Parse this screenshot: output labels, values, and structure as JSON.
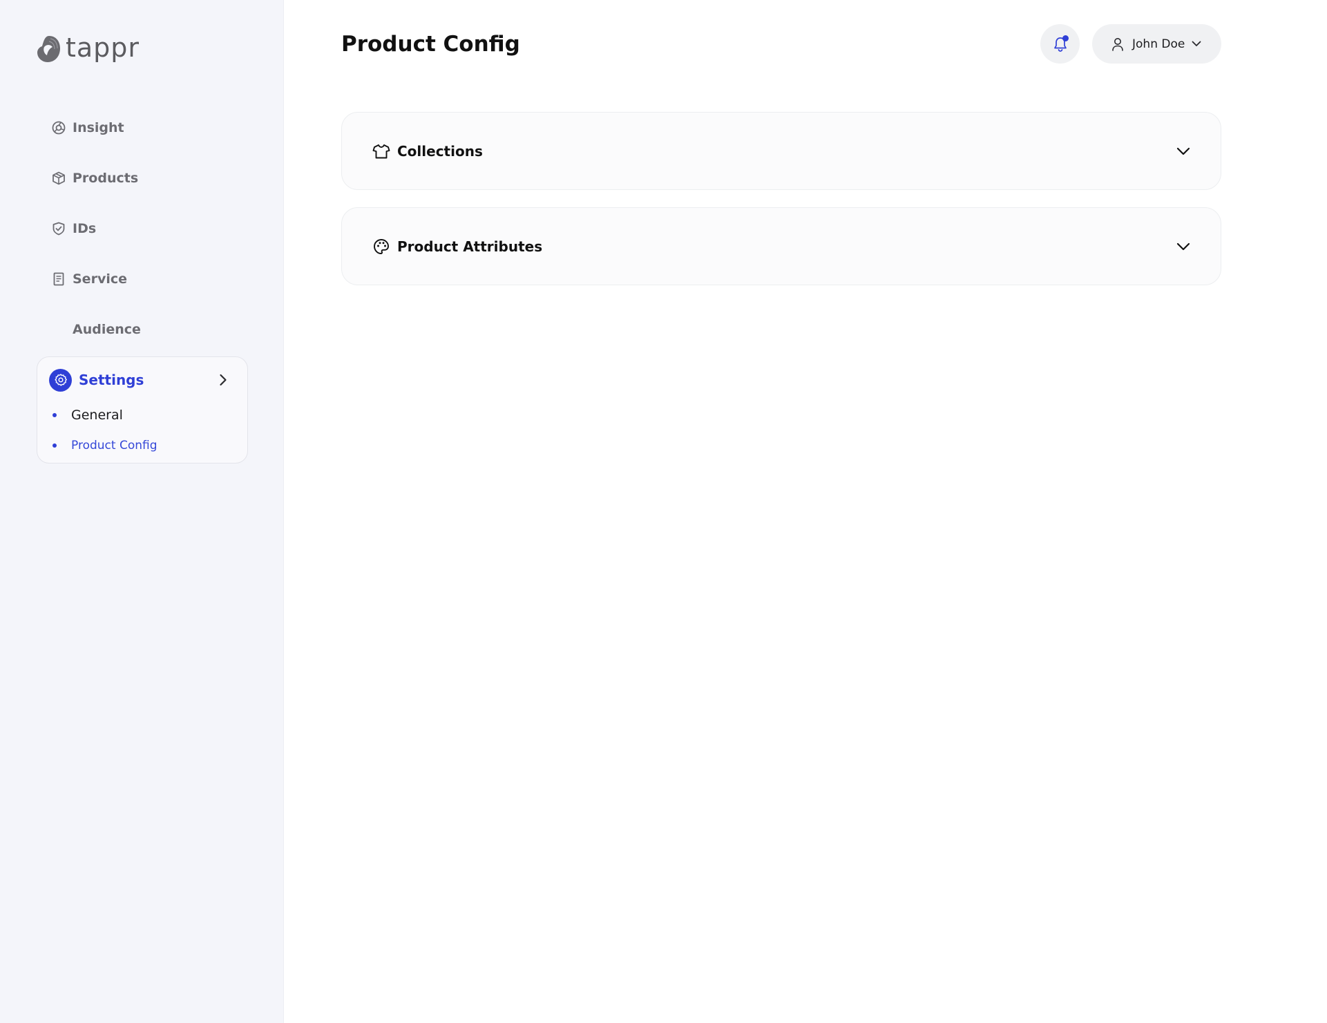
{
  "brand": {
    "name": "tappr"
  },
  "sidebar": {
    "items": [
      {
        "label": "Insight",
        "icon": "insight-icon"
      },
      {
        "label": "Products",
        "icon": "box-icon"
      },
      {
        "label": "IDs",
        "icon": "shield-check-icon"
      },
      {
        "label": "Service",
        "icon": "receipt-icon"
      },
      {
        "label": "Audience",
        "icon": "none"
      }
    ],
    "settings": {
      "label": "Settings",
      "icon": "gear-icon",
      "expanded": true,
      "subitems": [
        {
          "label": "General",
          "active": false
        },
        {
          "label": "Product Config",
          "active": true
        }
      ]
    }
  },
  "header": {
    "title": "Product Config",
    "notification": {
      "icon": "bell-icon",
      "has_unread": true
    },
    "user": {
      "name": "John Doe",
      "icon": "user-icon"
    }
  },
  "panels": [
    {
      "title": "Collections",
      "icon": "tshirt-icon",
      "expanded": false
    },
    {
      "title": "Product Attributes",
      "icon": "palette-icon",
      "expanded": false
    }
  ],
  "colors": {
    "accent": "#2f3fd6",
    "sidebar_bg": "#f4f5fa",
    "panel_bg": "#fbfbfc"
  }
}
